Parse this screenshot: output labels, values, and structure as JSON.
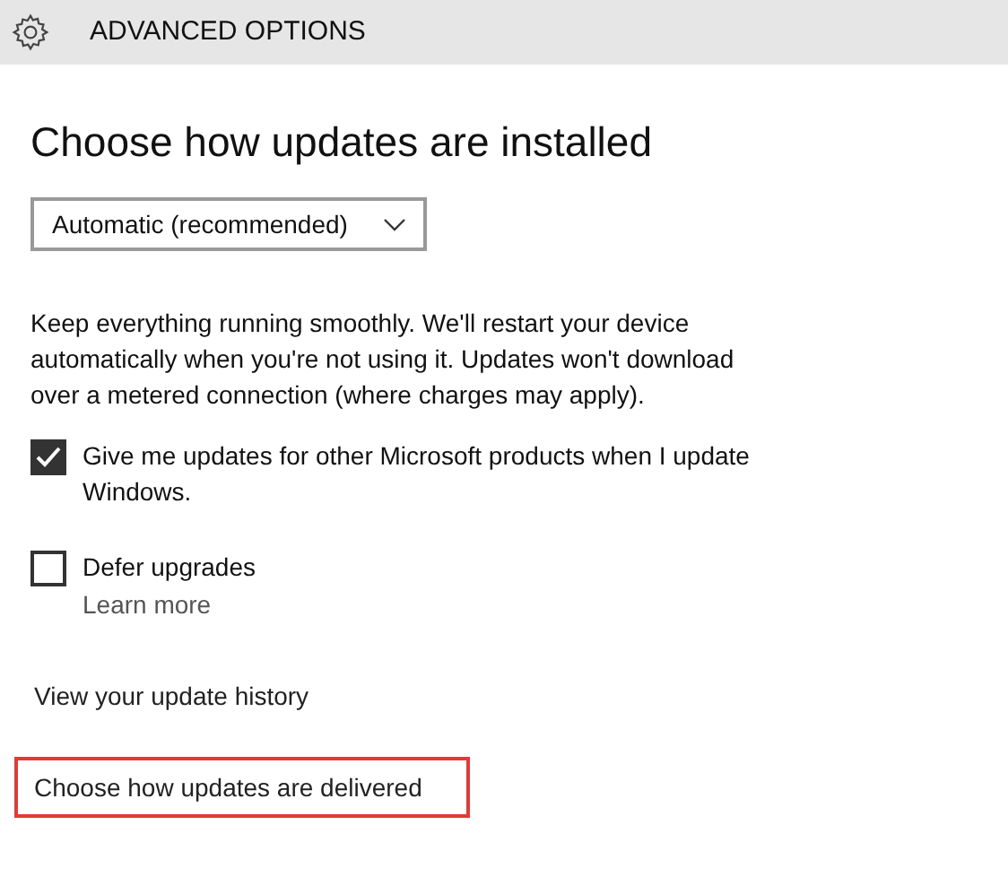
{
  "header": {
    "title": "ADVANCED OPTIONS"
  },
  "heading": "Choose how updates are installed",
  "dropdown": {
    "value": "Automatic (recommended)"
  },
  "description": "Keep everything running smoothly. We'll restart your device automatically when you're not using it. Updates won't download over a metered connection (where charges may apply).",
  "options": [
    {
      "label": "Give me updates for other Microsoft products when I update Windows.",
      "checked": true
    },
    {
      "label": "Defer upgrades",
      "checked": false,
      "link": "Learn more"
    }
  ],
  "links": [
    {
      "label": "View your update history",
      "highlighted": false
    },
    {
      "label": "Choose how updates are delivered",
      "highlighted": true
    }
  ]
}
